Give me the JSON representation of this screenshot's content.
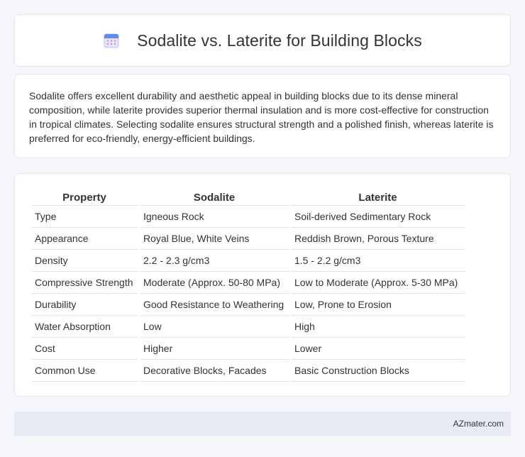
{
  "header": {
    "title": "Sodalite vs. Laterite for Building Blocks",
    "icon": "calendar-icon"
  },
  "intro": {
    "text": "Sodalite offers excellent durability and aesthetic appeal in building blocks due to its dense mineral composition, while laterite provides superior thermal insulation and is more cost-effective for construction in tropical climates. Selecting sodalite ensures structural strength and a polished finish, whereas laterite is preferred for eco-friendly, energy-efficient buildings."
  },
  "table": {
    "headers": [
      "Property",
      "Sodalite",
      "Laterite"
    ],
    "rows": [
      [
        "Type",
        "Igneous Rock",
        "Soil-derived Sedimentary Rock"
      ],
      [
        "Appearance",
        "Royal Blue, White Veins",
        "Reddish Brown, Porous Texture"
      ],
      [
        "Density",
        "2.2 - 2.3 g/cm3",
        "1.5 - 2.2 g/cm3"
      ],
      [
        "Compressive Strength",
        "Moderate (Approx. 50-80 MPa)",
        "Low to Moderate (Approx. 5-30 MPa)"
      ],
      [
        "Durability",
        "Good Resistance to Weathering",
        "Low, Prone to Erosion"
      ],
      [
        "Water Absorption",
        "Low",
        "High"
      ],
      [
        "Cost",
        "Higher",
        "Lower"
      ],
      [
        "Common Use",
        "Decorative Blocks, Facades",
        "Basic Construction Blocks"
      ]
    ]
  },
  "footer": {
    "brand": "AZmater.com"
  }
}
